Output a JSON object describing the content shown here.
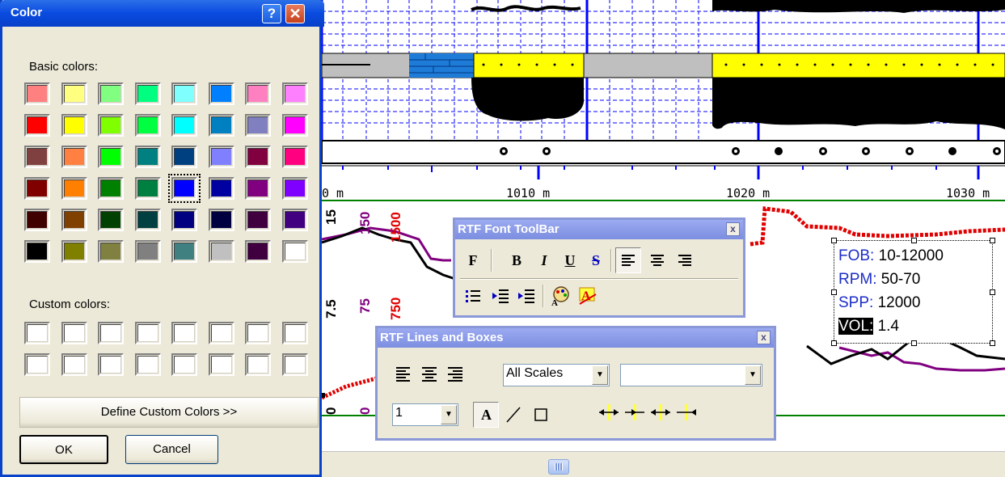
{
  "color_dialog": {
    "title": "Color",
    "help_glyph": "?",
    "close_glyph": "✕",
    "basic_colors_label": "Basic colors:",
    "custom_colors_label": "Custom colors:",
    "define_custom_label": "Define Custom Colors >>",
    "ok_label": "OK",
    "cancel_label": "Cancel",
    "selected_index": 28,
    "basic_colors": [
      "#ff8080",
      "#ffff80",
      "#80ff80",
      "#00ff80",
      "#80ffff",
      "#0080ff",
      "#ff80c0",
      "#ff80ff",
      "#ff0000",
      "#ffff00",
      "#80ff00",
      "#00ff40",
      "#00ffff",
      "#0080c0",
      "#8080c0",
      "#ff00ff",
      "#804040",
      "#ff8040",
      "#00ff00",
      "#008080",
      "#004080",
      "#8080ff",
      "#800040",
      "#ff0080",
      "#800000",
      "#ff8000",
      "#008000",
      "#008040",
      "#0000ff",
      "#0000a0",
      "#800080",
      "#8000ff",
      "#400000",
      "#804000",
      "#004000",
      "#004040",
      "#000080",
      "#000040",
      "#400040",
      "#400080",
      "#000000",
      "#808000",
      "#808040",
      "#808080",
      "#408080",
      "#c0c0c0",
      "#400040",
      "#ffffff"
    ],
    "custom_colors": [
      "#ffffff",
      "#ffffff",
      "#ffffff",
      "#ffffff",
      "#ffffff",
      "#ffffff",
      "#ffffff",
      "#ffffff",
      "#ffffff",
      "#ffffff",
      "#ffffff",
      "#ffffff",
      "#ffffff",
      "#ffffff",
      "#ffffff",
      "#ffffff"
    ]
  },
  "log": {
    "depth_labels": [
      "0 m",
      "1010 m",
      "1020 m",
      "1030 m"
    ],
    "track_numbers": [
      {
        "text": "15",
        "color": "#000000"
      },
      {
        "text": "150",
        "color": "#800080"
      },
      {
        "text": "1500",
        "color": "#e00000"
      },
      {
        "text": "7.5",
        "color": "#000000"
      },
      {
        "text": "75",
        "color": "#800080"
      },
      {
        "text": "750",
        "color": "#e00000"
      },
      {
        "text": "0",
        "color": "#000000"
      },
      {
        "text": "0",
        "color": "#800080"
      }
    ]
  },
  "font_toolbar": {
    "title": "RTF Font ToolBar",
    "close_glyph": "x",
    "buttons": [
      "F",
      "B",
      "I",
      "U",
      "S"
    ]
  },
  "lines_toolbar": {
    "title": "RTF Lines and Boxes",
    "close_glyph": "x",
    "scale_select": "All Scales",
    "empty_select": "",
    "line_width": "1",
    "text_button": "A"
  },
  "textbox": {
    "lines": [
      {
        "key": "FOB:",
        "value": " 10-12000"
      },
      {
        "key": "RPM:",
        "value": " 50-70"
      },
      {
        "key": "SPP:",
        "value": " 12000"
      },
      {
        "key": "VOL:",
        "value": " 1.4"
      }
    ]
  }
}
